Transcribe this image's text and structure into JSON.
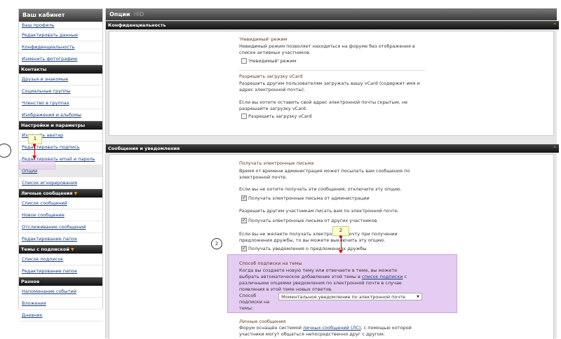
{
  "sidebar": {
    "title": "Ваш кабинет",
    "items": [
      {
        "type": "link",
        "label": "Ваш профиль"
      },
      {
        "type": "link",
        "label": "Редактировать данные"
      },
      {
        "type": "link",
        "label": "Конфиденциальность"
      },
      {
        "type": "link",
        "label": "Изменить фотографию"
      },
      {
        "type": "section",
        "label": "Контакты"
      },
      {
        "type": "link",
        "label": "Друзья и знакомые"
      },
      {
        "type": "link",
        "label": "Социальные группы"
      },
      {
        "type": "link",
        "label": "Членство в группах"
      },
      {
        "type": "link",
        "label": "Изображения и альбомы"
      },
      {
        "type": "section",
        "label": "Настройки и параметры"
      },
      {
        "type": "link",
        "label": "Изменить аватар"
      },
      {
        "type": "link",
        "label": "Редактировать подпись"
      },
      {
        "type": "link",
        "label": "Редактировать email и пароль"
      },
      {
        "type": "link",
        "label": "Опции"
      },
      {
        "type": "link",
        "label": "Список игнорирования"
      },
      {
        "type": "section",
        "label": "Личные сообщения"
      },
      {
        "type": "link",
        "label": "Список сообщений"
      },
      {
        "type": "link",
        "label": "Новое сообщение"
      },
      {
        "type": "link",
        "label": "Отслеживание сообщений"
      },
      {
        "type": "link",
        "label": "Редактирование папок"
      },
      {
        "type": "section",
        "label": "Темы с подпиской"
      },
      {
        "type": "link",
        "label": "Список подписок"
      },
      {
        "type": "link",
        "label": "Редактирование папок"
      },
      {
        "type": "section",
        "label": "Разное"
      },
      {
        "type": "link",
        "label": "Напоминание событий"
      },
      {
        "type": "link",
        "label": "Вложения"
      },
      {
        "type": "link",
        "label": "Дневник"
      }
    ]
  },
  "main": {
    "title": "Опции",
    "title_suffix": ": HID",
    "privacy": {
      "header": "Конфиденциальность",
      "invisible_title": "'Невидимый' режим",
      "invisible_desc": "Невидимый режим позволяет находиться на форуме без отображения в списке активных участников.",
      "invisible_checkbox": "'Невидимый' режим",
      "vcard_title": "Разрешить загрузку vCard",
      "vcard_desc1": "Разрешить другим пользователям загружать вашу vCard (содержит имя и адрес электронной почты).",
      "vcard_desc2": "Если вы хотите оставить свой адрес электронной почты скрытым, не разрешайте загрузку vCard.",
      "vcard_checkbox": "Разрешить загрузку vCard"
    },
    "messages": {
      "header": "Сообщения и уведомления",
      "email_title": "Получать электронные письма",
      "email_desc1": "Время от времени администрация может посылать вам сообщения по электронной почте.",
      "email_desc2": "Если вы не хотите получать эти сообщения, отключите эту опцию.",
      "email_cb_admin": "Получать электронные письма от администрации",
      "email_desc3": "Разрешить другим участникам писать вам по электронной почте.",
      "email_cb_users": "Получать электронные письма от других участников",
      "email_desc4": "Если вы не желаете получать электронную почту при получении предложения дружбы, то вы можете выключить эту опцию.",
      "email_cb_friend": "Получать уведомления о предложениях дружбы",
      "sub_title": "Способ подписки на темы",
      "sub_desc_pre": "Когда вы создаете новую тему или отвечаете в теме, вы можете выбрать автоматическое добавление этой темы в ",
      "sub_desc_link": "список подписки",
      "sub_desc_post": " с различными опциями уведомления по электронной почте в случае появления в этой теме новых ответов.",
      "sub_label": "Способ подписки на темы:",
      "sub_select_value": "Моментальное уведомление по электронной почте",
      "pm_title": "Личные сообщения",
      "pm_desc_pre": "Форум оснащён системой ",
      "pm_desc_link": "личных сообщений (ЛС)",
      "pm_desc_post": ", с помощью которой участники могут общаться непосредственно друг с другом."
    }
  },
  "annotations": {
    "note1": "1",
    "note2": "2",
    "circle2": "2"
  },
  "icons": {
    "collapse": "collapse-arrows-icon",
    "dropdown": "triangle-down-icon",
    "checkbox": "checkbox-icon"
  },
  "colors": {
    "highlight": "#e5ccf2",
    "note": "#ffffcc",
    "arrow": "#dd0000",
    "section_title": "#5a3c1a"
  }
}
